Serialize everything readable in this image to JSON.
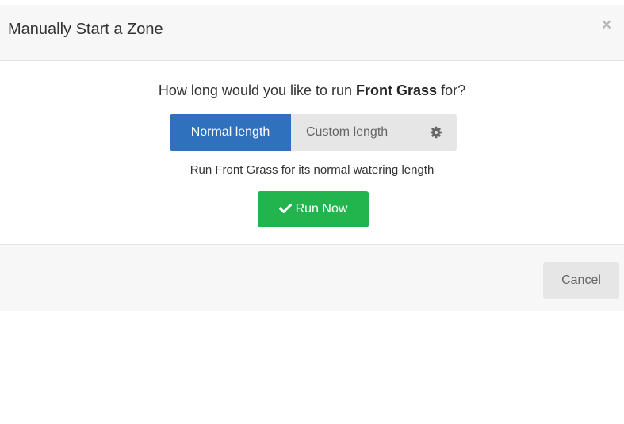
{
  "modal": {
    "title": "Manually Start a Zone",
    "close_label": "×"
  },
  "body": {
    "question_prefix": "How long would you like to run ",
    "zone_name": "Front Grass",
    "question_suffix": " for?",
    "options": {
      "normal_label": "Normal length",
      "custom_label": "Custom length",
      "selected": "Normal length"
    },
    "description": "Run Front Grass for its normal watering length",
    "run_label": "Run Now"
  },
  "footer": {
    "cancel_label": "Cancel"
  },
  "icons": {
    "close": "close-icon",
    "settings": "gear-icon",
    "run": "check-icon"
  },
  "colors": {
    "primary": "#3071bd",
    "success": "#23b54d",
    "default": "#e6e6e6",
    "header_bg": "#f7f7f7"
  }
}
